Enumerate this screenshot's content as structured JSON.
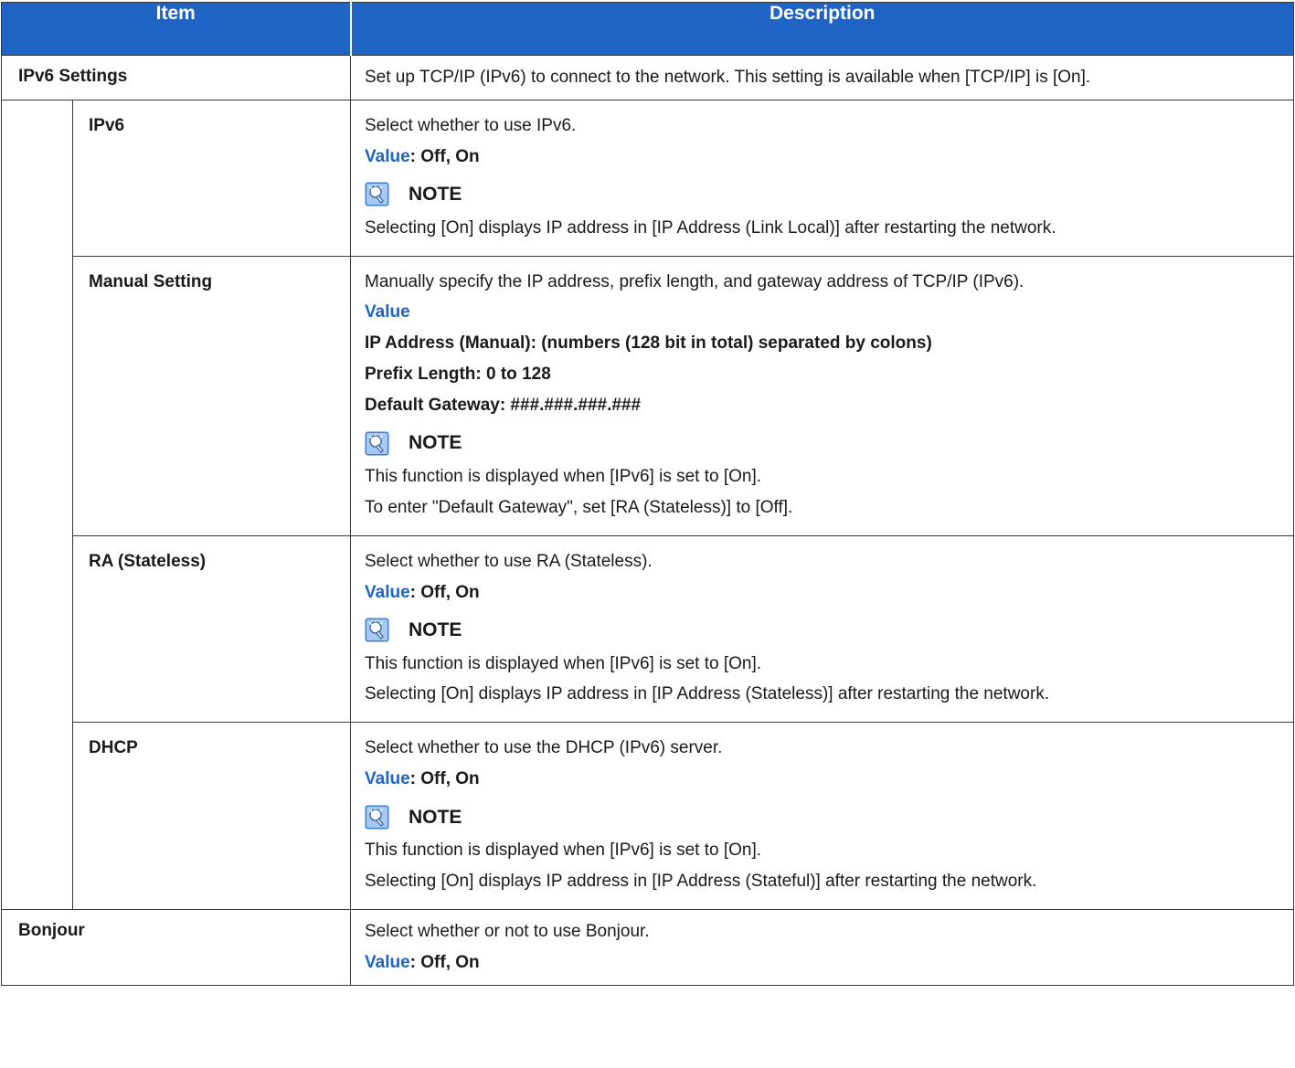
{
  "header": {
    "item": "Item",
    "description": "Description"
  },
  "rows": {
    "ipv6_settings": {
      "item": "IPv6 Settings",
      "desc": "Set up TCP/IP (IPv6) to connect to the network. This setting is available when [TCP/IP] is [On]."
    },
    "ipv6": {
      "item": "IPv6",
      "desc": "Select whether to use IPv6.",
      "value_label": "Value",
      "value_text": ": Off, On",
      "note_title": "NOTE",
      "note_lines": [
        "Selecting [On] displays IP address in [IP Address (Link Local)] after restarting the network."
      ]
    },
    "manual": {
      "item": "Manual Setting",
      "desc": "Manually specify the IP address, prefix length, and gateway address of TCP/IP (IPv6).",
      "value_label": "Value",
      "value_lines": [
        "IP Address (Manual): (numbers (128 bit in total) separated by colons)",
        "Prefix Length: 0 to 128",
        "Default Gateway: ###.###.###.###"
      ],
      "note_title": "NOTE",
      "note_lines": [
        "This function is displayed when [IPv6] is set to [On].",
        "To enter \"Default Gateway\", set [RA (Stateless)] to [Off]."
      ]
    },
    "ra": {
      "item": "RA (Stateless)",
      "desc": "Select whether to use RA (Stateless).",
      "value_label": "Value",
      "value_text": ": Off, On",
      "note_title": "NOTE",
      "note_lines": [
        "This function is displayed when [IPv6] is set to [On].",
        "Selecting [On] displays IP address in [IP Address (Stateless)] after restarting the network."
      ]
    },
    "dhcp": {
      "item": "DHCP",
      "desc": "Select whether to use the DHCP (IPv6) server.",
      "value_label": "Value",
      "value_text": ": Off, On",
      "note_title": "NOTE",
      "note_lines": [
        "This function is displayed when [IPv6] is set to [On].",
        "Selecting [On] displays IP address in [IP Address (Stateful)] after restarting the network."
      ]
    },
    "bonjour": {
      "item": "Bonjour",
      "desc": "Select whether or not to use Bonjour.",
      "value_label": "Value",
      "value_text": ": Off, On"
    }
  },
  "colors": {
    "header_bg": "#1f63c5",
    "value_label": "#1f63c5"
  },
  "icons": {
    "note": "note-lightbulb-icon"
  }
}
